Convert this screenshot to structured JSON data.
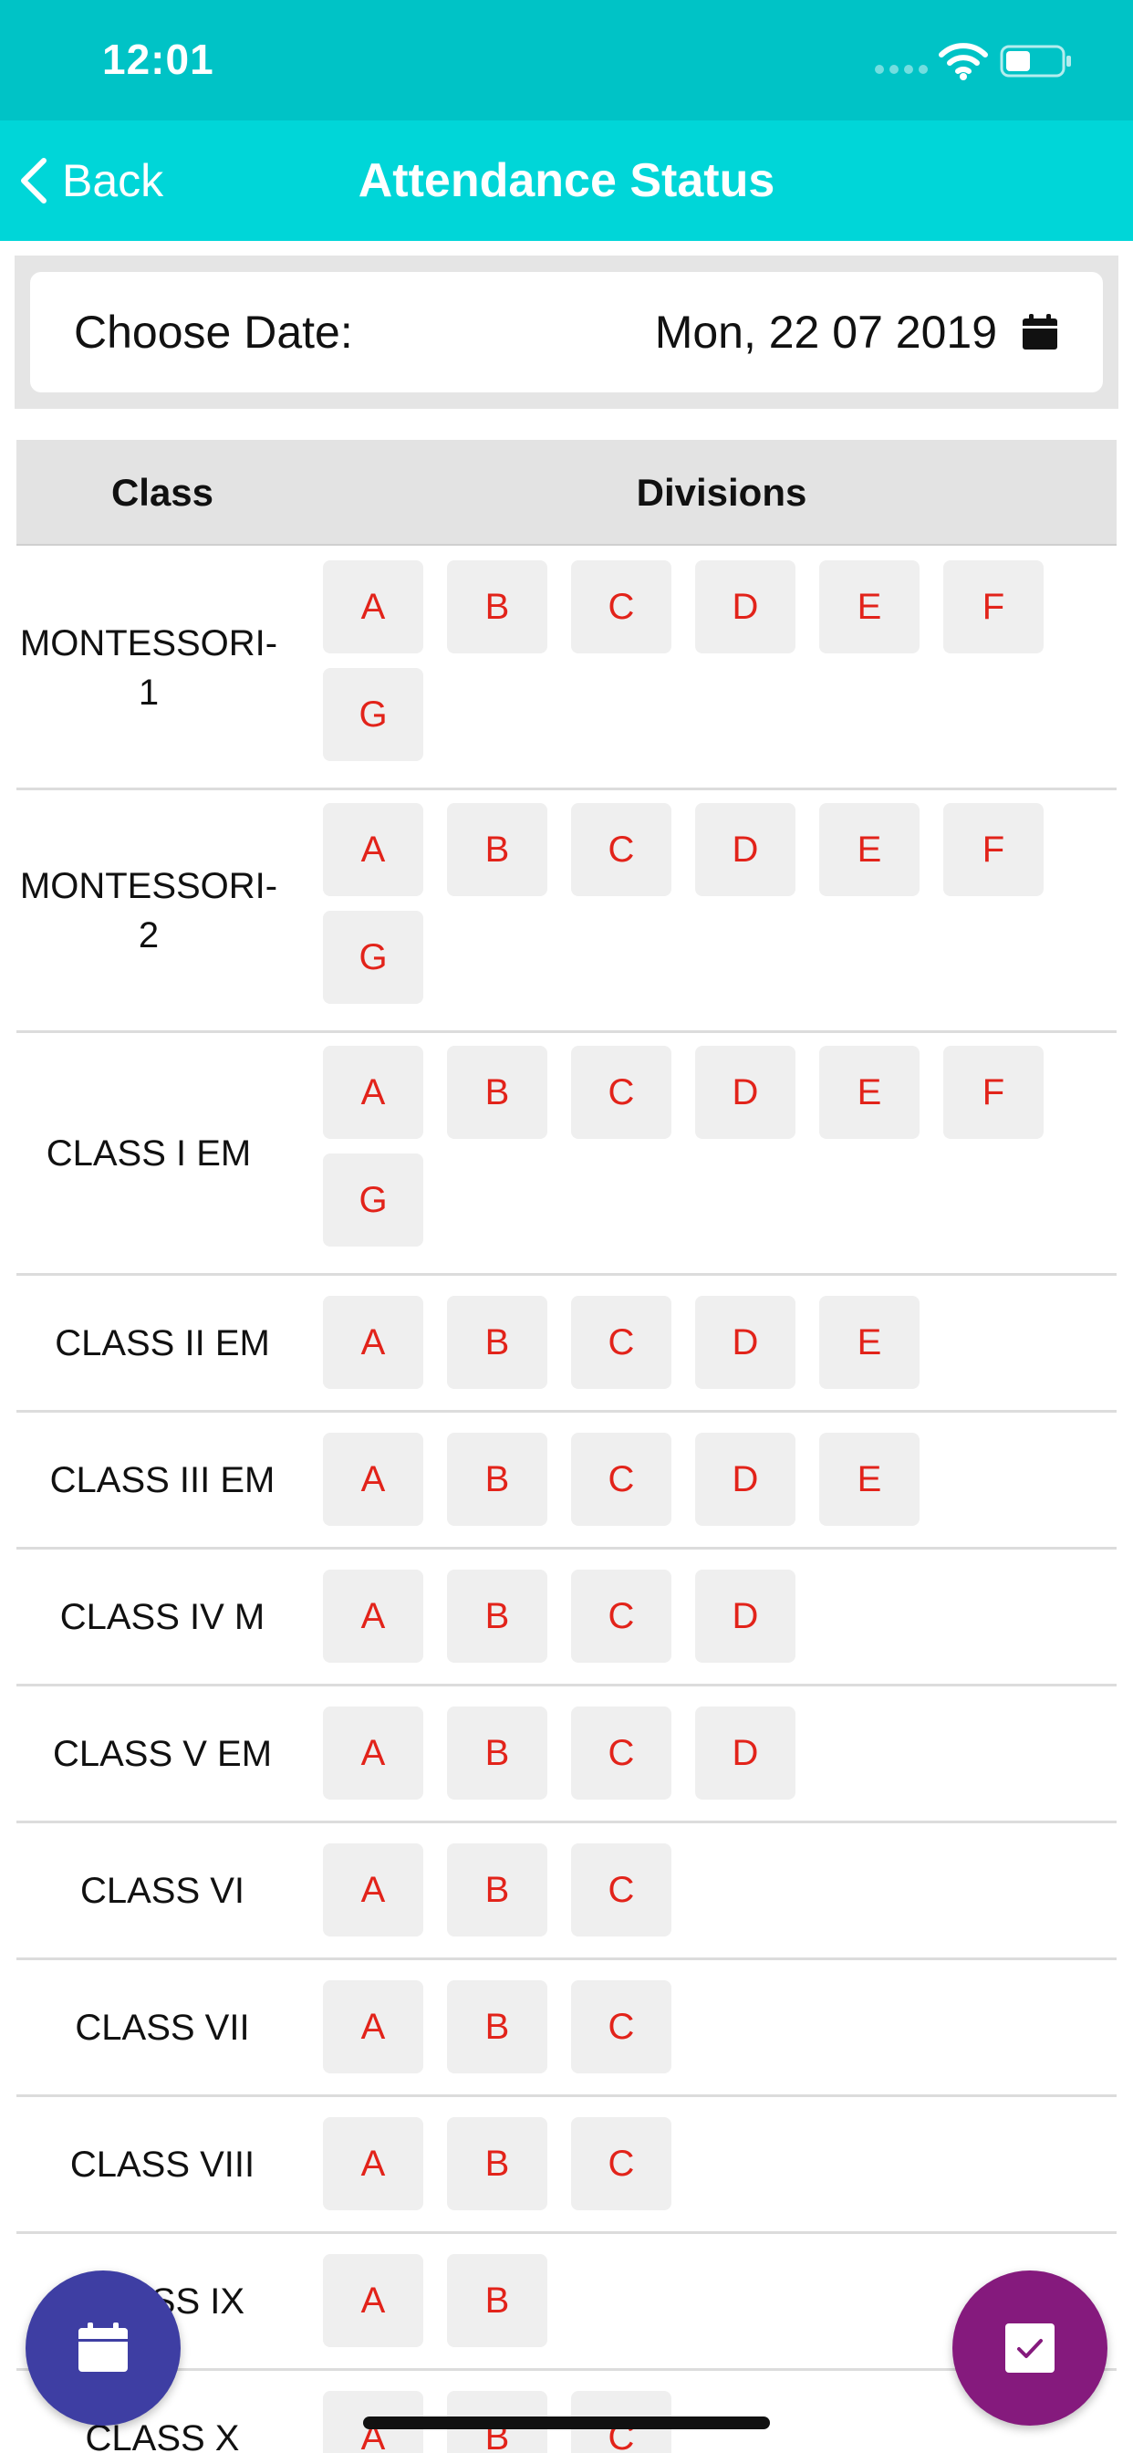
{
  "status_bar": {
    "time": "12:01"
  },
  "nav": {
    "back_label": "Back",
    "title": "Attendance Status"
  },
  "date": {
    "label": "Choose Date:",
    "value": "Mon, 22 07 2019"
  },
  "table": {
    "headers": {
      "class": "Class",
      "divisions": "Divisions"
    },
    "rows": [
      {
        "class": "MONTESSORI-1",
        "divisions": [
          "A",
          "B",
          "C",
          "D",
          "E",
          "F",
          "G"
        ]
      },
      {
        "class": "MONTESSORI-2",
        "divisions": [
          "A",
          "B",
          "C",
          "D",
          "E",
          "F",
          "G"
        ]
      },
      {
        "class": "CLASS I EM",
        "divisions": [
          "A",
          "B",
          "C",
          "D",
          "E",
          "F",
          "G"
        ]
      },
      {
        "class": "CLASS II EM",
        "divisions": [
          "A",
          "B",
          "C",
          "D",
          "E"
        ]
      },
      {
        "class": "CLASS III EM",
        "divisions": [
          "A",
          "B",
          "C",
          "D",
          "E"
        ]
      },
      {
        "class": "CLASS IV M",
        "divisions": [
          "A",
          "B",
          "C",
          "D"
        ]
      },
      {
        "class": "CLASS V EM",
        "divisions": [
          "A",
          "B",
          "C",
          "D"
        ]
      },
      {
        "class": "CLASS VI",
        "divisions": [
          "A",
          "B",
          "C"
        ]
      },
      {
        "class": "CLASS VII",
        "divisions": [
          "A",
          "B",
          "C"
        ]
      },
      {
        "class": "CLASS VIII",
        "divisions": [
          "A",
          "B",
          "C"
        ]
      },
      {
        "class": "CLASS IX",
        "divisions": [
          "A",
          "B"
        ]
      },
      {
        "class": "CLASS X",
        "divisions": [
          "A",
          "B",
          "C"
        ]
      }
    ]
  },
  "icons": {
    "date_picker": "calendar-icon",
    "fab_left": "calendar-icon",
    "fab_right": "checkbox-icon"
  },
  "colors": {
    "status_bar": "#00c3c6",
    "nav_bar": "#00d6d8",
    "division_text": "#e2231a",
    "fab_left": "#3e3ea3",
    "fab_right": "#851a7d"
  }
}
